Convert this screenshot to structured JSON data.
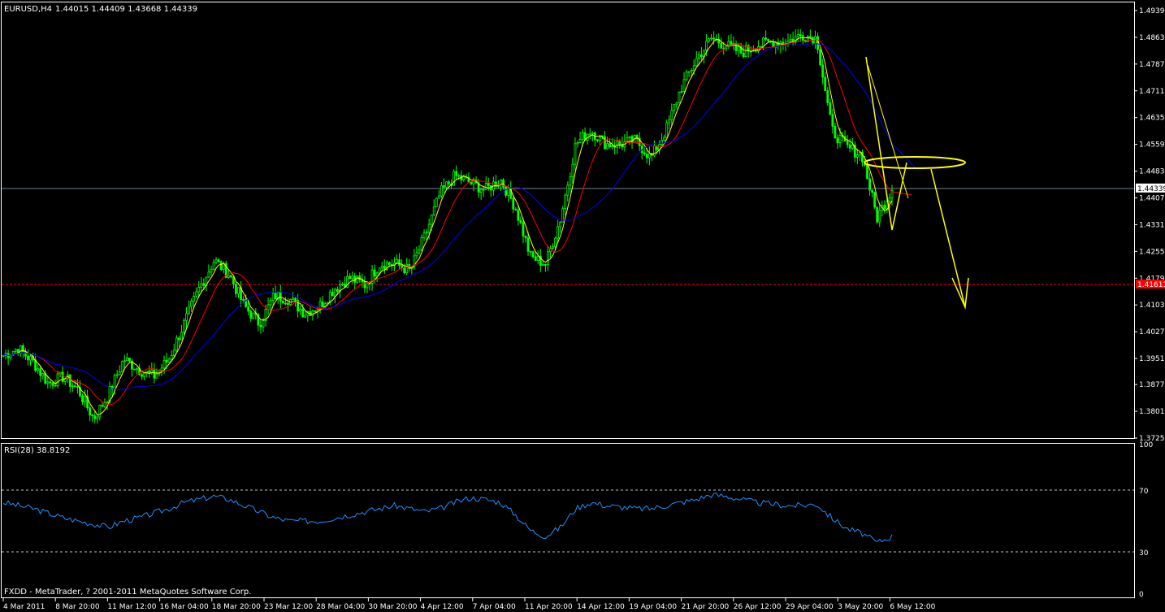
{
  "header": {
    "symbol_label": "EURUSD,H4",
    "ohlc": "1.44015 1.44409 1.43668 1.44339"
  },
  "footer": {
    "copyright": "FXDD - MetaTrader, ? 2001-2011 MetaQuotes Software Corp."
  },
  "colors": {
    "background": "#000000",
    "frame": "#ffffff",
    "candle": "#00ff00",
    "ma_fast": "#ffff00",
    "ma_mid": "#ff0000",
    "ma_slow": "#0000ff",
    "rsi_line": "#1e90ff",
    "drawing": "#ffff00",
    "bid_line": "#708090",
    "level_line": "#ff0000"
  },
  "chart_data": [
    {
      "type": "candlestick",
      "title": "EURUSD,H4",
      "price_axis_ticks": [
        "1.49390",
        "1.48630",
        "1.47870",
        "1.47110",
        "1.46350",
        "1.45590",
        "1.44830",
        "1.44070",
        "1.43310",
        "1.42550",
        "1.41790",
        "1.41030",
        "1.40270",
        "1.39510",
        "1.38770",
        "1.38010",
        "1.37250"
      ],
      "ylim": [
        1.3725,
        1.4962
      ],
      "time_axis_labels": [
        "4 Mar 2011",
        "8 Mar 20:00",
        "11 Mar 12:00",
        "16 Mar 04:00",
        "18 Mar 20:00",
        "23 Mar 12:00",
        "28 Mar 04:00",
        "30 Mar 20:00",
        "4 Apr 12:00",
        "7 Apr 04:00",
        "11 Apr 20:00",
        "14 Apr 12:00",
        "19 Apr 04:00",
        "21 Apr 20:00",
        "26 Apr 12:00",
        "29 Apr 04:00",
        "3 May 20:00",
        "6 May 12:00"
      ],
      "current_price_label": "1.44339",
      "marked_level_label": "1.41611",
      "current_price": 1.44339,
      "marked_level": 1.41611,
      "price_path": [
        1.396,
        1.398,
        1.394,
        1.388,
        1.39,
        1.386,
        1.378,
        1.385,
        1.395,
        1.392,
        1.39,
        1.395,
        1.405,
        1.415,
        1.423,
        1.419,
        1.41,
        1.405,
        1.413,
        1.412,
        1.408,
        1.41,
        1.415,
        1.418,
        1.416,
        1.422,
        1.422,
        1.42,
        1.43,
        1.442,
        1.447,
        1.445,
        1.443,
        1.446,
        1.438,
        1.424,
        1.422,
        1.435,
        1.456,
        1.46,
        1.456,
        1.456,
        1.457,
        1.452,
        1.46,
        1.472,
        1.48,
        1.486,
        1.484,
        1.482,
        1.484,
        1.485,
        1.485,
        1.487,
        1.486,
        1.46,
        1.455,
        1.453,
        1.435,
        1.4434
      ],
      "moving_averages": [
        {
          "color": "#ffff00",
          "period_hint": "fast"
        },
        {
          "color": "#ff0000",
          "period_hint": "medium"
        },
        {
          "color": "#0000ff",
          "period_hint": "slow"
        }
      ]
    },
    {
      "type": "line",
      "title": "RSI(28) 38.8192",
      "indicator_label": "RSI(28) 38.8192",
      "ylim": [
        0,
        100
      ],
      "axis_ticks": [
        "100",
        "70",
        "30",
        "0"
      ],
      "levels": [
        70,
        30
      ],
      "values": [
        62,
        60,
        58,
        55,
        52,
        50,
        48,
        46,
        50,
        52,
        55,
        58,
        62,
        64,
        66,
        64,
        60,
        56,
        52,
        50,
        50,
        50,
        52,
        54,
        56,
        58,
        60,
        58,
        56,
        58,
        62,
        65,
        64,
        62,
        54,
        44,
        40,
        46,
        58,
        62,
        60,
        59,
        58,
        58,
        60,
        62,
        64,
        67,
        66,
        64,
        62,
        61,
        60,
        60,
        61,
        52,
        45,
        42,
        36,
        40
      ]
    }
  ]
}
